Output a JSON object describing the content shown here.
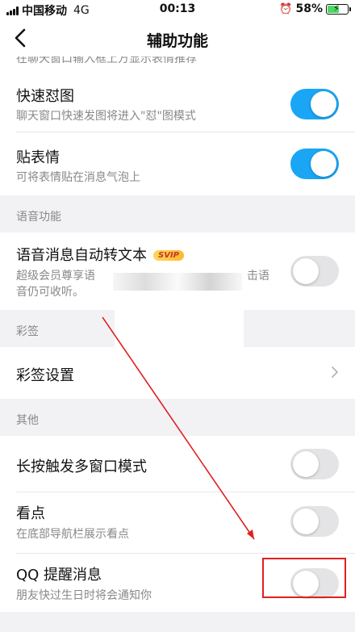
{
  "status_bar": {
    "carrier": "中国移动",
    "network": "4G",
    "time": "00:13",
    "battery_percent": "58%",
    "battery_level": 0.58
  },
  "nav": {
    "title": "辅助功能"
  },
  "top_cut_text": "在聊天窗口输入框上方显示表情推荐",
  "rows": {
    "quick_image": {
      "title": "快速怼图",
      "subtitle": "聊天窗口快速发图将进入\"怼\"图模式",
      "enabled": true
    },
    "sticker": {
      "title": "贴表情",
      "subtitle": "可将表情贴在消息气泡上",
      "enabled": true
    },
    "voice_to_text": {
      "title": "语音消息自动转文本",
      "badge": "SVIP",
      "subtitle_line1": "超级会员尊享语",
      "subtitle_line1_end": "击语",
      "subtitle_line2": "音仍可收听。",
      "enabled": false
    },
    "caiqian": {
      "title": "彩签设置"
    },
    "long_press": {
      "title": "长按触发多窗口模式",
      "enabled": false
    },
    "kandian": {
      "title": "看点",
      "subtitle": "在底部导航栏展示看点",
      "enabled": false
    },
    "qq_remind": {
      "title": "QQ 提醒消息",
      "subtitle": "朋友快过生日时将会通知你",
      "enabled": false
    }
  },
  "sections": {
    "voice": "语音功能",
    "caiqian": "彩签",
    "other": "其他"
  },
  "colors": {
    "toggle_on": "#1aa6f4",
    "toggle_off": "#e4e4e6",
    "annotation": "#e02020"
  }
}
